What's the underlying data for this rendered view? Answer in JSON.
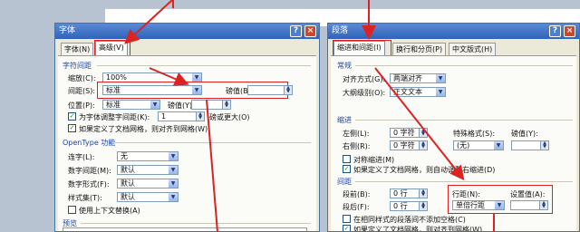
{
  "font_dialog": {
    "title": "字体",
    "tabs": [
      {
        "label": "字体(N)"
      },
      {
        "label": "高级(V)"
      }
    ],
    "char_spacing": "字符间距",
    "scale_label": "缩放(C):",
    "scale_value": "100%",
    "spacing_label": "间距(S):",
    "spacing_value": "标准",
    "spacing_by": "磅值(B):",
    "position_label": "位置(P):",
    "position_value": "标准",
    "position_by": "磅值(Y):",
    "kerning_label": "为字体调整字间距(K):",
    "kerning_value": "1",
    "kerning_suffix": "磅或更大(O)",
    "grid_label": "如果定义了文档网格，则对齐到网格(W)",
    "opentype": "OpenType 功能",
    "ligature_label": "连字(L):",
    "ligature_value": "无",
    "numspacing_label": "数字间距(M):",
    "numspacing_value": "默认",
    "numform_label": "数字形式(F):",
    "numform_value": "默认",
    "styleset_label": "样式集(T):",
    "styleset_value": "默认",
    "context_label": "使用上下文替换(A)",
    "preview": "预览"
  },
  "para_dialog": {
    "title": "段落",
    "tabs": [
      {
        "label": "缩进和间距(I)"
      },
      {
        "label": "换行和分页(P)"
      },
      {
        "label": "中文版式(H)"
      }
    ],
    "general": "常规",
    "align_label": "对齐方式(G):",
    "align_value": "两端对齐",
    "outline_label": "大纲级别(O):",
    "outline_value": "正文文本",
    "indent": "缩进",
    "left_label": "左侧(L):",
    "left_value": "0 字符",
    "right_label": "右侧(R):",
    "right_value": "0 字符",
    "special_label": "特殊格式(S):",
    "special_value": "(无)",
    "by_label": "磅值(Y):",
    "mirror_label": "对称缩进(M)",
    "autogrid_label": "如果定义了文档网格，则自动调整右缩进(D)",
    "spacing": "间距",
    "before_label": "段前(B):",
    "before_value": "0 行",
    "after_label": "段后(F):",
    "after_value": "0 行",
    "linespacing_label": "行距(N):",
    "linespacing_value": "单倍行距",
    "setvalue_label": "设置值(A):",
    "nospace_label": "在相同样式的段落间不添加空格(C)",
    "snapgrid_label": "如果定义了文档网格，则对齐到网格(W)"
  },
  "title_buttons": {
    "help": "?",
    "close": "×"
  },
  "colors": {
    "accent": "#dd2222",
    "title": "#2f63b9"
  }
}
